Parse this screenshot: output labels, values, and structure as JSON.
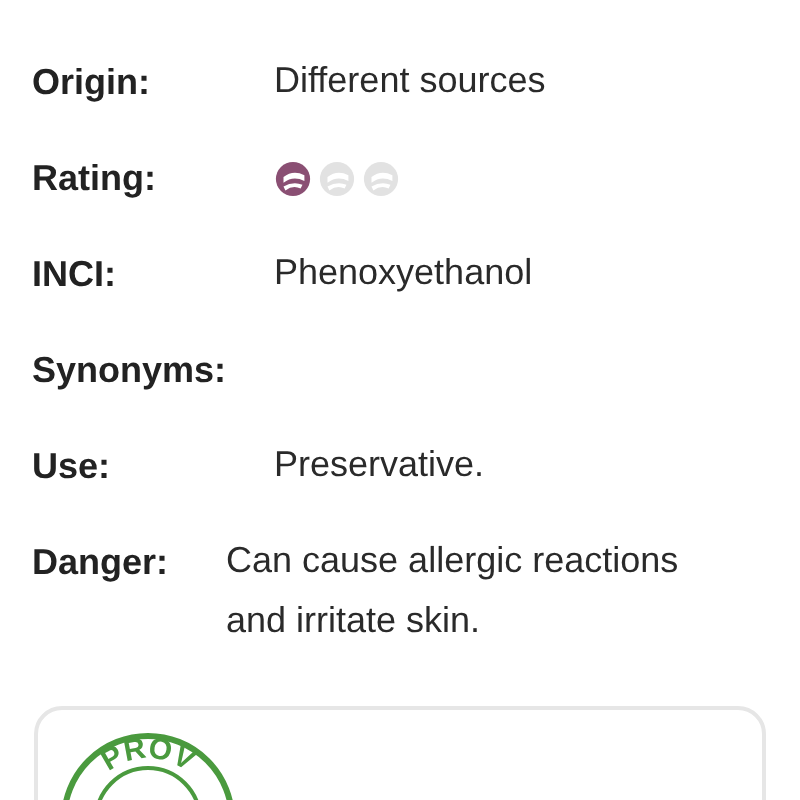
{
  "fields": [
    {
      "label": "Origin:",
      "value": "Different sources"
    },
    {
      "label": "Rating:",
      "stars": 1
    },
    {
      "label": "INCI:",
      "value": "Phenoxyethanol"
    },
    {
      "label": "Synonyms:"
    },
    {
      "label": "Use:",
      "value": "Preservative."
    },
    {
      "label": "Danger:",
      "value": "Can cause allergic reactions and irritate skin.",
      "wide": true
    }
  ],
  "card": {
    "stamp_text": "PROV"
  }
}
